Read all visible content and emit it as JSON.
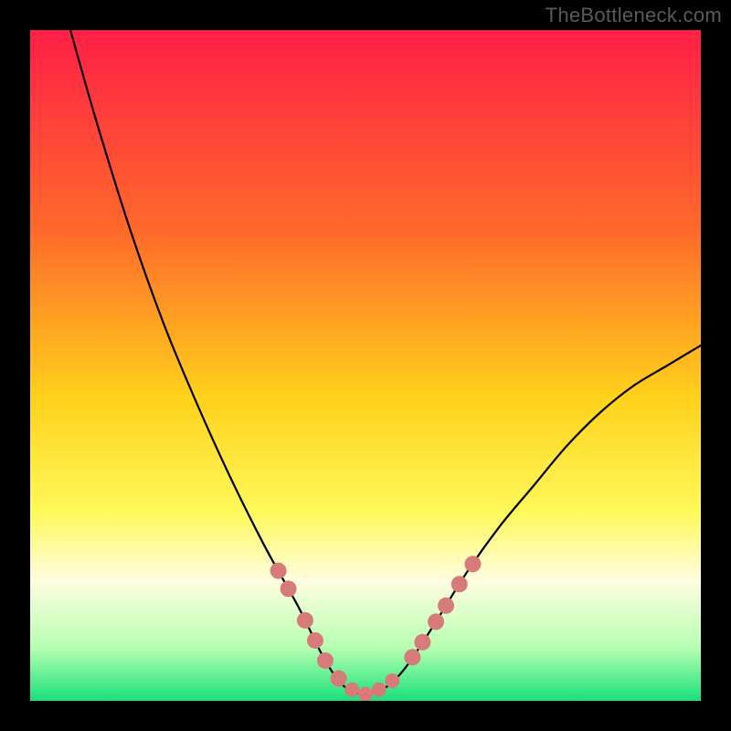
{
  "watermark": "TheBottleneck.com",
  "chart_data": {
    "type": "line",
    "title": "",
    "xlabel": "",
    "ylabel": "",
    "xlim": [
      0,
      100
    ],
    "ylim": [
      0,
      100
    ],
    "gradient_stops": [
      {
        "offset": 0,
        "color": "#ff1f47"
      },
      {
        "offset": 30,
        "color": "#ff6a2a"
      },
      {
        "offset": 55,
        "color": "#ffd21c"
      },
      {
        "offset": 72,
        "color": "#fff95b"
      },
      {
        "offset": 82,
        "color": "#fffde0"
      },
      {
        "offset": 92,
        "color": "#b8ffb2"
      },
      {
        "offset": 100,
        "color": "#18e07a"
      }
    ],
    "series": [
      {
        "name": "bottleneck-curve",
        "points": [
          {
            "x": 6,
            "y": 100
          },
          {
            "x": 10,
            "y": 86
          },
          {
            "x": 15,
            "y": 70
          },
          {
            "x": 20,
            "y": 56
          },
          {
            "x": 25,
            "y": 44
          },
          {
            "x": 30,
            "y": 33
          },
          {
            "x": 35,
            "y": 23
          },
          {
            "x": 40,
            "y": 14
          },
          {
            "x": 44,
            "y": 6
          },
          {
            "x": 47,
            "y": 2
          },
          {
            "x": 50,
            "y": 1
          },
          {
            "x": 53,
            "y": 2
          },
          {
            "x": 56,
            "y": 5
          },
          {
            "x": 60,
            "y": 11
          },
          {
            "x": 65,
            "y": 19
          },
          {
            "x": 70,
            "y": 26
          },
          {
            "x": 75,
            "y": 32
          },
          {
            "x": 80,
            "y": 38
          },
          {
            "x": 85,
            "y": 43
          },
          {
            "x": 90,
            "y": 47
          },
          {
            "x": 95,
            "y": 50
          },
          {
            "x": 100,
            "y": 53
          }
        ]
      }
    ],
    "marker_color": "#d77a7a",
    "markers_left": [
      37,
      38.5,
      41,
      42.5,
      44,
      46
    ],
    "markers_bottom": [
      48,
      50,
      52,
      54
    ],
    "markers_right": [
      57,
      58.5,
      60.5,
      62,
      64,
      66
    ]
  },
  "plot": {
    "outer_w": 800,
    "outer_h": 800,
    "inner_x": 33,
    "inner_y": 33,
    "inner_w": 734,
    "inner_h": 734
  }
}
